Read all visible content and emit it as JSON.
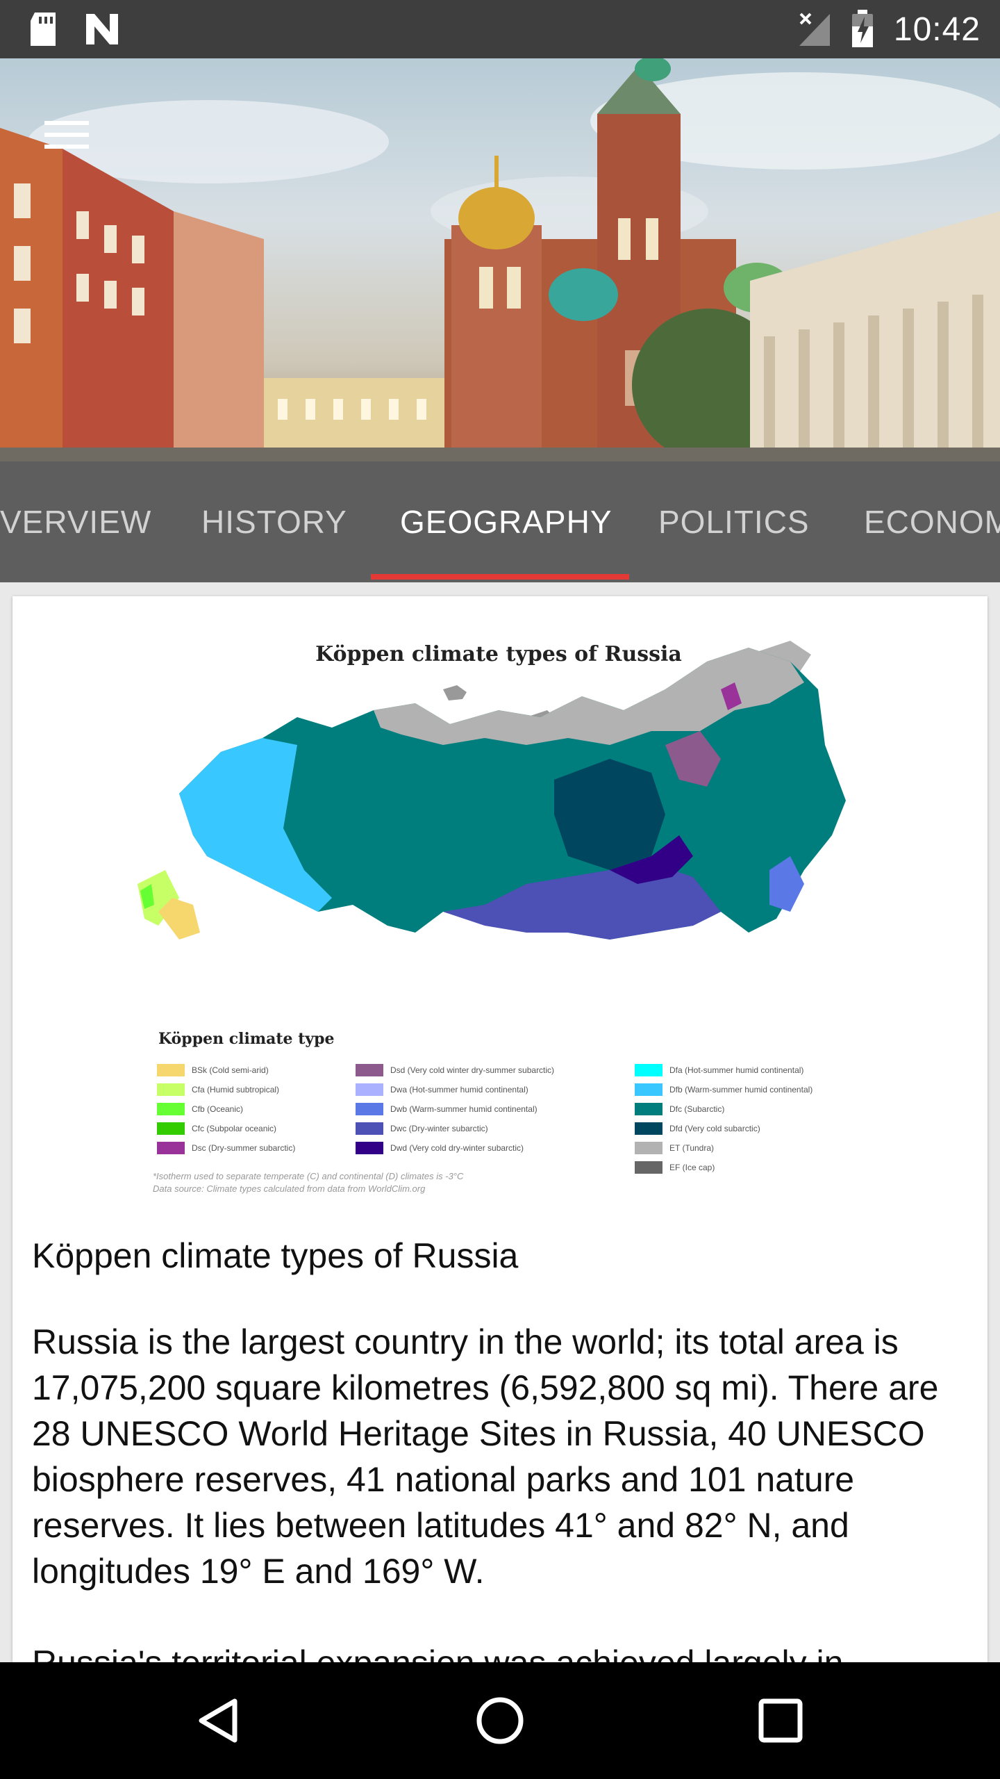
{
  "status_bar": {
    "time": "10:42",
    "icons": [
      "sd-card-icon",
      "notification-n-icon",
      "signal-no-service-icon",
      "battery-charging-icon"
    ]
  },
  "hero": {
    "image_alt": "Church of the Savior on Spilled Blood, Saint Petersburg",
    "menu_icon": "hamburger-menu-icon"
  },
  "tabs": [
    {
      "label": "VERVIEW",
      "active": false
    },
    {
      "label": "HISTORY",
      "active": false
    },
    {
      "label": "GEOGRAPHY",
      "active": true
    },
    {
      "label": "POLITICS",
      "active": false
    },
    {
      "label": "ECONOM",
      "active": false
    }
  ],
  "accent_color": "#e53935",
  "map": {
    "title": "Köppen climate types of Russia",
    "legend_title": "Köppen climate type",
    "legend_columns": [
      [
        {
          "code": "BSk (Cold semi-arid)",
          "color": "#f5d76e"
        },
        {
          "code": "Cfa (Humid subtropical)",
          "color": "#c6ff66"
        },
        {
          "code": "Cfb (Oceanic)",
          "color": "#66ff33"
        },
        {
          "code": "Cfc (Subpolar oceanic)",
          "color": "#33cc00"
        },
        {
          "code": "Dsc (Dry-summer subarctic)",
          "color": "#993399"
        }
      ],
      [
        {
          "code": "Dsd (Very cold winter dry-summer subarctic)",
          "color": "#8c5a8c"
        },
        {
          "code": "Dwa (Hot-summer humid continental)",
          "color": "#aab2ff"
        },
        {
          "code": "Dwb (Warm-summer humid continental)",
          "color": "#5a78e6"
        },
        {
          "code": "Dwc (Dry-winter subarctic)",
          "color": "#4d50b4"
        },
        {
          "code": "Dwd (Very cold dry-winter subarctic)",
          "color": "#320087"
        }
      ],
      [
        {
          "code": "Dfa (Hot-summer humid continental)",
          "color": "#00ffff"
        },
        {
          "code": "Dfb (Warm-summer humid continental)",
          "color": "#38c7ff"
        },
        {
          "code": "Dfc (Subarctic)",
          "color": "#007d7d"
        },
        {
          "code": "Dfd (Very cold subarctic)",
          "color": "#00465f"
        },
        {
          "code": "ET (Tundra)",
          "color": "#b2b2b2"
        },
        {
          "code": "EF (Ice cap)",
          "color": "#666666"
        }
      ]
    ],
    "note_line1": "*Isotherm used to separate temperate (C) and continental (D) climates is -3°C",
    "note_line2": "Data source: Climate types calculated from data from WorldClim.org"
  },
  "content": {
    "caption": "Köppen climate types of Russia",
    "paragraph": "Russia is the largest country in the world; its total area is 17,075,200 square kilometres (6,592,800 sq mi). There are 28 UNESCO World Heritage Sites in Russia, 40 UNESCO biosphere reserves, 41 national parks and 101 nature reserves. It lies between latitudes 41° and 82° N, and longitudes 19° E and 169° W.",
    "next_paragraph_start": "Russia's territorial expansion was achieved largely in"
  },
  "nav_bar": {
    "buttons": [
      "back-icon",
      "home-icon",
      "recents-icon"
    ]
  }
}
